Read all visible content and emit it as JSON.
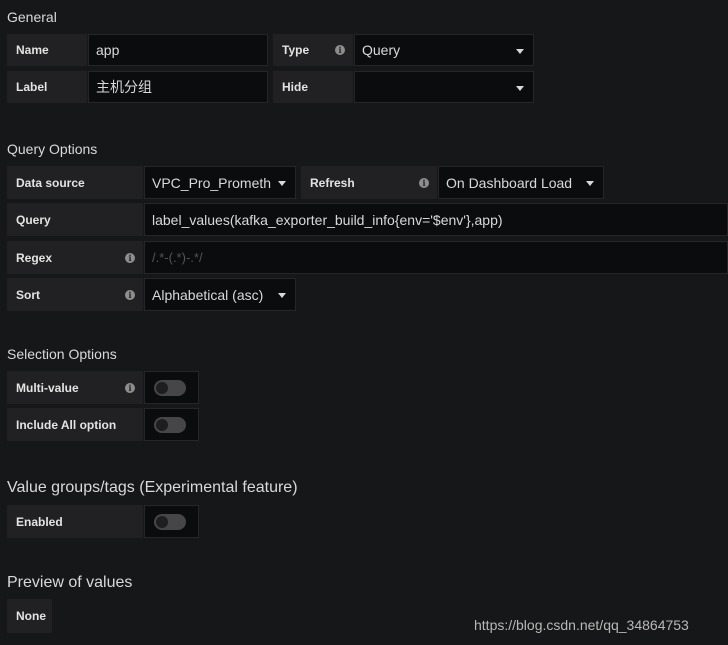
{
  "sections": {
    "general": "General",
    "query_options": "Query Options",
    "selection_options": "Selection Options",
    "value_groups": "Value groups/tags (Experimental feature)",
    "preview": "Preview of values"
  },
  "general": {
    "name_label": "Name",
    "name_value": "app",
    "type_label": "Type",
    "type_value": "Query",
    "label_label": "Label",
    "label_value": "主机分组",
    "hide_label": "Hide",
    "hide_value": ""
  },
  "query_options": {
    "datasource_label": "Data source",
    "datasource_value": "VPC_Pro_Prometh",
    "refresh_label": "Refresh",
    "refresh_value": "On Dashboard Load",
    "query_label": "Query",
    "query_value": "label_values(kafka_exporter_build_info{env='$env'},app)",
    "regex_label": "Regex",
    "regex_placeholder": "/.*-(.*)-.*/",
    "sort_label": "Sort",
    "sort_value": "Alphabetical (asc)"
  },
  "selection_options": {
    "multi_value_label": "Multi-value",
    "multi_value_on": false,
    "include_all_label": "Include All option",
    "include_all_on": false
  },
  "value_groups": {
    "enabled_label": "Enabled",
    "enabled_on": false
  },
  "preview": {
    "none_label": "None"
  },
  "icons": {
    "info": "i"
  },
  "watermark": "https://blog.csdn.net/qq_34864753"
}
